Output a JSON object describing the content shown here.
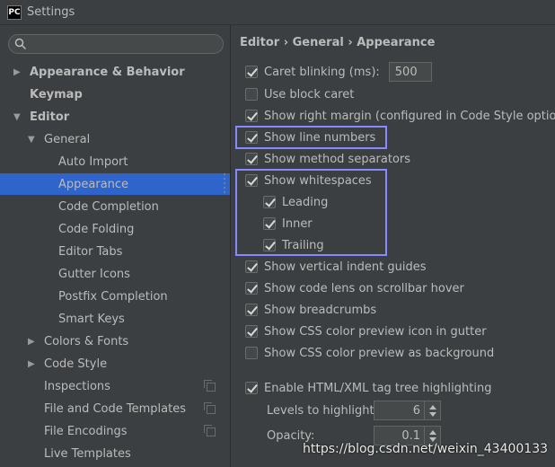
{
  "window": {
    "title": "Settings",
    "app_badge": "PC"
  },
  "sidebar": {
    "search_placeholder": "",
    "items": [
      {
        "label": "Appearance & Behavior",
        "arrow": "▶"
      },
      {
        "label": "Keymap",
        "arrow": ""
      },
      {
        "label": "Editor",
        "arrow": "▼"
      },
      {
        "label": "General",
        "arrow": "▼"
      },
      {
        "label": "Auto Import",
        "arrow": ""
      },
      {
        "label": "Appearance",
        "arrow": ""
      },
      {
        "label": "Code Completion",
        "arrow": ""
      },
      {
        "label": "Code Folding",
        "arrow": ""
      },
      {
        "label": "Editor Tabs",
        "arrow": ""
      },
      {
        "label": "Gutter Icons",
        "arrow": ""
      },
      {
        "label": "Postfix Completion",
        "arrow": ""
      },
      {
        "label": "Smart Keys",
        "arrow": ""
      },
      {
        "label": "Colors & Fonts",
        "arrow": "▶"
      },
      {
        "label": "Code Style",
        "arrow": "▶"
      },
      {
        "label": "Inspections",
        "arrow": ""
      },
      {
        "label": "File and Code Templates",
        "arrow": ""
      },
      {
        "label": "File Encodings",
        "arrow": ""
      },
      {
        "label": "Live Templates",
        "arrow": ""
      }
    ]
  },
  "breadcrumb": "Editor › General › Appearance",
  "options": {
    "caret_blinking": {
      "label": "Caret blinking (ms):",
      "value": "500"
    },
    "block_caret": "Use block caret",
    "right_margin": "Show right margin (configured in Code Style options)",
    "line_numbers": "Show line numbers",
    "method_separators": "Show method separators",
    "whitespaces": "Show whitespaces",
    "leading": "Leading",
    "inner": "Inner",
    "trailing": "Trailing",
    "indent_guides": "Show vertical indent guides",
    "code_lens": "Show code lens on scrollbar hover",
    "breadcrumbs": "Show breadcrumbs",
    "css_gutter": "Show CSS color preview icon in gutter",
    "css_background": "Show CSS color preview as background",
    "tag_tree": "Enable HTML/XML tag tree highlighting",
    "levels": {
      "label": "Levels to highlight:",
      "value": "6"
    },
    "opacity": {
      "label": "Opacity:",
      "value": "0.1"
    }
  },
  "watermark": "https://blog.csdn.net/weixin_43400133",
  "colors": {
    "background": "#3c3f41",
    "selection": "#2f65ca",
    "highlight_box": "#8989ff"
  }
}
